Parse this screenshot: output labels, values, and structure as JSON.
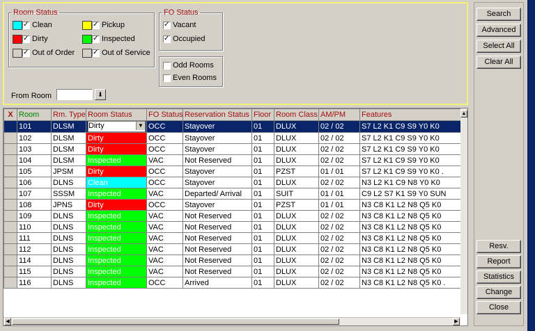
{
  "filters": {
    "room_status": {
      "legend": "Room Status",
      "items": [
        {
          "label": "Clean",
          "color": "#00ffff",
          "checked": true
        },
        {
          "label": "Dirty",
          "color": "#ff0000",
          "checked": true
        },
        {
          "label": "Out of Order",
          "color": "#d4d0c8",
          "checked": true
        },
        {
          "label": "Pickup",
          "color": "#ffff00",
          "checked": true
        },
        {
          "label": "Inspected",
          "color": "#00ff00",
          "checked": true
        },
        {
          "label": "Out of Service",
          "color": "#d4d0c8",
          "checked": true
        }
      ]
    },
    "fo_status": {
      "legend": "FO Status",
      "items": [
        {
          "label": "Vacant",
          "checked": true
        },
        {
          "label": "Occupied",
          "checked": true
        }
      ]
    },
    "rooms_parity": {
      "items": [
        {
          "label": "Odd Rooms",
          "checked": false
        },
        {
          "label": "Even Rooms",
          "checked": false
        }
      ]
    },
    "from_room": {
      "label": "From Room",
      "value": "",
      "button_glyph": "⬇"
    }
  },
  "buttons_top": [
    "Search",
    "Advanced",
    "Select All",
    "Clear All"
  ],
  "buttons_bottom": [
    "Resv.",
    "Report",
    "Statistics",
    "Change",
    "Close"
  ],
  "grid": {
    "columns": [
      "X",
      "Room",
      "Rm. Type",
      "Room Status",
      "FO Status",
      "Reservation Status",
      "Floor",
      "Room Class",
      "AM/PM",
      "Features"
    ],
    "rows": [
      {
        "room": "101",
        "type": "DLSM",
        "status": "Dirty",
        "fo": "OCC",
        "resv": "Stayover",
        "floor": "01",
        "class": "DLUX",
        "ampm": "02 / 02",
        "features": "S7 L2 K1 C9 S9 Y0 K0",
        "selected": true
      },
      {
        "room": "102",
        "type": "DLSM",
        "status": "Dirty",
        "fo": "OCC",
        "resv": "Stayover",
        "floor": "01",
        "class": "DLUX",
        "ampm": "02 / 02",
        "features": "S7 L2 K1 C9 S9 Y0 K0"
      },
      {
        "room": "103",
        "type": "DLSM",
        "status": "Dirty",
        "fo": "OCC",
        "resv": "Stayover",
        "floor": "01",
        "class": "DLUX",
        "ampm": "02 / 02",
        "features": "S7 L2 K1 C9 S9 Y0 K0"
      },
      {
        "room": "104",
        "type": "DLSM",
        "status": "Inspected",
        "fo": "VAC",
        "resv": "Not Reserved",
        "floor": "01",
        "class": "DLUX",
        "ampm": "02 / 02",
        "features": "S7 L2 K1 C9 S9 Y0 K0"
      },
      {
        "room": "105",
        "type": "JPSM",
        "status": "Dirty",
        "fo": "OCC",
        "resv": "Stayover",
        "floor": "01",
        "class": "PZST",
        "ampm": "01 / 01",
        "features": "S7 L2 K1 C9 S9 Y0 K0 ."
      },
      {
        "room": "106",
        "type": "DLNS",
        "status": "Clean",
        "fo": "OCC",
        "resv": "Stayover",
        "floor": "01",
        "class": "DLUX",
        "ampm": "02 / 02",
        "features": "N3 L2 K1 C9 N8 Y0 K0"
      },
      {
        "room": "107",
        "type": "SSSM",
        "status": "Inspected",
        "fo": "VAC",
        "resv": "Departed/ Arrival",
        "floor": "01",
        "class": "SUIT",
        "ampm": "01 / 01",
        "features": "C9 L2 S7 K1 S9 Y0 SUN"
      },
      {
        "room": "108",
        "type": "JPNS",
        "status": "Dirty",
        "fo": "OCC",
        "resv": "Stayover",
        "floor": "01",
        "class": "PZST",
        "ampm": "01 / 01",
        "features": "N3 C8 K1 L2 N8 Q5 K0"
      },
      {
        "room": "109",
        "type": "DLNS",
        "status": "Inspected",
        "fo": "VAC",
        "resv": "Not Reserved",
        "floor": "01",
        "class": "DLUX",
        "ampm": "02 / 02",
        "features": "N3 C8 K1 L2 N8 Q5 K0"
      },
      {
        "room": "110",
        "type": "DLNS",
        "status": "Inspected",
        "fo": "VAC",
        "resv": "Not Reserved",
        "floor": "01",
        "class": "DLUX",
        "ampm": "02 / 02",
        "features": "N3 C8 K1 L2 N8 Q5 K0"
      },
      {
        "room": "111",
        "type": "DLNS",
        "status": "Inspected",
        "fo": "VAC",
        "resv": "Not Reserved",
        "floor": "01",
        "class": "DLUX",
        "ampm": "02 / 02",
        "features": "N3 C8 K1 L2 N8 Q5 K0"
      },
      {
        "room": "112",
        "type": "DLNS",
        "status": "Inspected",
        "fo": "VAC",
        "resv": "Not Reserved",
        "floor": "01",
        "class": "DLUX",
        "ampm": "02 / 02",
        "features": "N3 C8 K1 L2 N8 Q5 K0"
      },
      {
        "room": "114",
        "type": "DLNS",
        "status": "Inspected",
        "fo": "VAC",
        "resv": "Not Reserved",
        "floor": "01",
        "class": "DLUX",
        "ampm": "02 / 02",
        "features": "N3 C8 K1 L2 N8 Q5 K0"
      },
      {
        "room": "115",
        "type": "DLNS",
        "status": "Inspected",
        "fo": "VAC",
        "resv": "Not Reserved",
        "floor": "01",
        "class": "DLUX",
        "ampm": "02 / 02",
        "features": "N3 C8 K1 L2 N8 Q5 K0"
      },
      {
        "room": "116",
        "type": "DLNS",
        "status": "Inspected",
        "fo": "OCC",
        "resv": "Arrived",
        "floor": "01",
        "class": "DLUX",
        "ampm": "02 / 02",
        "features": "N3 C8 K1 L2 N8 Q5 K0 ."
      }
    ]
  },
  "icons": {
    "dropdown": "▼",
    "scroll_up": "▲",
    "scroll_left": "◀",
    "scroll_right": "▶"
  }
}
